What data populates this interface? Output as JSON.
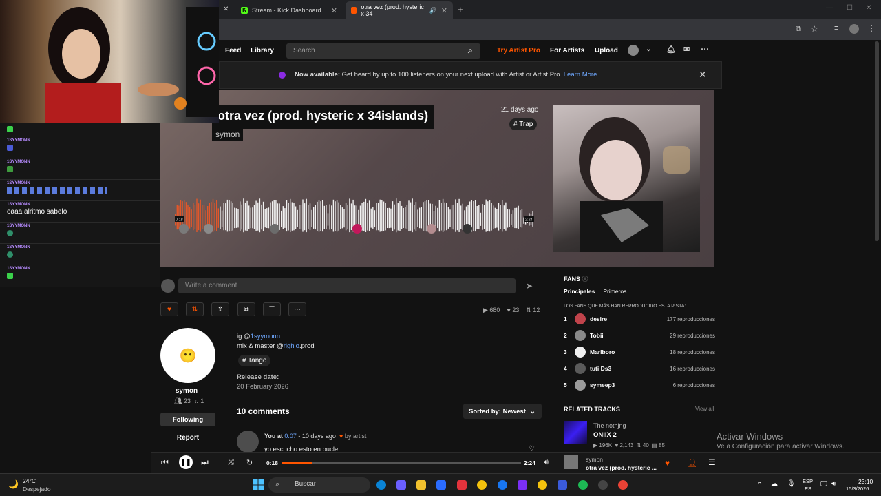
{
  "browser": {
    "tabs": [
      {
        "label": "Stream - Kick Dashboard"
      },
      {
        "label": "otra vez (prod. hysteric x 34"
      }
    ]
  },
  "nav": {
    "feed": "Feed",
    "library": "Library",
    "search_placeholder": "Search",
    "try_pro": "Try Artist Pro",
    "for_artists": "For Artists",
    "upload": "Upload"
  },
  "banner": {
    "bold": "Now available:",
    "text": " Get heard by up to 100 listeners on your next upload with Artist or Artist Pro.",
    "link": "Learn More"
  },
  "track": {
    "title": "otra vez (prod. hysteric x 34islands)",
    "artist": "symon",
    "posted": "21 days ago",
    "tag": "# Trap",
    "time_start": "0:18",
    "time_end": "2:24"
  },
  "chat": {
    "user": "1SYYMONN",
    "message": "oaaa alritmo sabelo"
  },
  "comment_input_placeholder": "Write a comment",
  "stats": {
    "plays": "680",
    "likes": "23",
    "reposts": "12"
  },
  "artist_card": {
    "name": "symon",
    "followers": "23",
    "tracks": "1",
    "following_btn": "Following",
    "report": "Report"
  },
  "description": {
    "line1_prefix": "ig @",
    "line1_link": "1syymonn",
    "line2_prefix": "mix & master @",
    "line2_link": "righlo",
    "line2_suffix": ".prod",
    "tag": "# Tango",
    "release_label": "Release date:",
    "release_date": "20 February 2026"
  },
  "comments": {
    "count_label": "10 comments",
    "sort_label": "Sorted by: Newest",
    "first": {
      "author": "You at",
      "time": "0:07",
      "ago": " - 10 days ago",
      "by_artist": "by artist",
      "body": "yo escucho esto en bucle"
    }
  },
  "fans": {
    "title": "FANS",
    "tab_main": "Principales",
    "tab_first": "Primeros",
    "subtitle": "LOS FANS QUE MÁS HAN REPRODUCIDO ESTA PISTA:",
    "list": [
      {
        "rank": "1",
        "name": "desire",
        "plays": "177 reproducciones"
      },
      {
        "rank": "2",
        "name": "Tobii",
        "plays": "29 reproducciones"
      },
      {
        "rank": "3",
        "name": "Marlboro",
        "plays": "18 reproducciones"
      },
      {
        "rank": "4",
        "name": "tuti Ds3",
        "plays": "16 reproducciones"
      },
      {
        "rank": "5",
        "name": "symeep3",
        "plays": "6 reproducciones"
      }
    ]
  },
  "related": {
    "title": "RELATED TRACKS",
    "view_all": "View all",
    "artist": "The nothjng",
    "track": "ONIIX 2",
    "plays": "196K",
    "likes": "2,143",
    "reposts": "40",
    "comments": "85"
  },
  "activate": {
    "line1": "Activar Windows",
    "line2": "Ve a Configuración para activar Windows."
  },
  "player": {
    "current": "0:18",
    "total": "2:24",
    "progress": 0.125,
    "artist": "symon",
    "title": "otra vez (prod. hysteric ..."
  },
  "taskbar": {
    "temp": "24°C",
    "weather": "Despejado",
    "search": "Buscar",
    "lang_top": "ESP",
    "lang_bottom": "ES",
    "time": "23:10",
    "date": "15/3/2026"
  },
  "colors": {
    "accent": "#ff5500",
    "link": "#6fa8ff"
  }
}
